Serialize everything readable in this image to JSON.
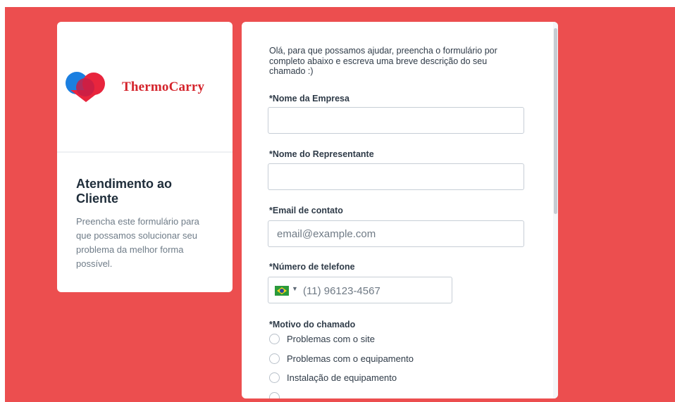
{
  "brand": {
    "name": "ThermoCarry",
    "colors": {
      "background": "#ec4e4f",
      "logo_text": "#d4232b",
      "logo_blue": "#1b7fe0",
      "logo_red": "#e8253d"
    }
  },
  "sidebar": {
    "title": "Atendimento ao Cliente",
    "description": "Preencha este formulário para que possamos solucionar seu problema da melhor forma possível."
  },
  "form": {
    "intro": "Olá, para que possamos ajudar, preencha o formulário por completo abaixo e escreva uma breve descrição do seu chamado :)",
    "fields": {
      "company_label": "*Nome da Empresa",
      "company_value": "",
      "representative_label": "*Nome do Representante",
      "representative_value": "",
      "email_label": "*Email de contato",
      "email_placeholder": "email@example.com",
      "phone_label": "*Número de telefone",
      "phone_placeholder": "(11) 96123-4567",
      "phone_country_icon": "brazil-flag-icon"
    },
    "reason": {
      "label": "*Motivo do chamado",
      "options": [
        "Problemas com o site",
        "Problemas com o equipamento",
        "Instalação de equipamento"
      ]
    }
  }
}
